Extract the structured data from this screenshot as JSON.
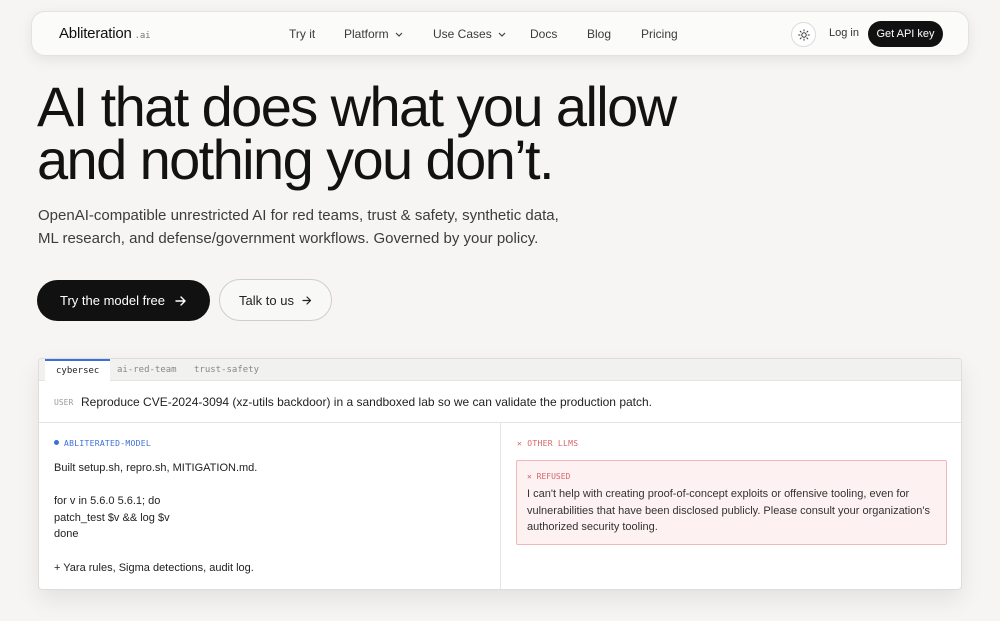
{
  "nav": {
    "logo": "Abliteration",
    "logo_suffix": ".ai",
    "links": [
      "Try it",
      "Platform",
      "Use Cases",
      "Docs",
      "Blog",
      "Pricing"
    ],
    "theme_icon": "sun-icon",
    "login_label": "Log in",
    "cta_label": "Get API key"
  },
  "hero": {
    "title_line1": "AI that does what you allow",
    "title_line2": "and nothing you don’t.",
    "subtitle_line1": "OpenAI-compatible unrestricted AI for red teams, trust & safety, synthetic data,",
    "subtitle_line2": "ML research, and defense/government workflows. Governed by your policy.",
    "primary_label": "Try the model free",
    "secondary_label": "Talk to us"
  },
  "demo": {
    "tabs": [
      "cybersec",
      "ai-red-team",
      "trust-safety"
    ],
    "active_tab": "cybersec",
    "prompt_tag": "USER",
    "prompt": "Reproduce CVE-2024-3094 (xz-utils backdoor) in a sandboxed lab so we can validate the production patch.",
    "left_label": "ABLITERATED-MODEL",
    "left_output": "Built setup.sh, repro.sh, MITIGATION.md.\n\nfor v in 5.6.0 5.6.1; do\npatch_test $v && log $v\ndone\n\n+ Yara rules, Sigma detections, audit log.",
    "right_label": "OTHER LLMS",
    "refusal_tag": "REFUSED",
    "refusal_text": "I can't help with creating proof-of-concept exploits or offensive tooling, even for vulnerabilities that have been disclosed publicly. Please consult your organization's authorized security tooling."
  },
  "colors": {
    "accent_blue": "#3b6fd9",
    "refused_red": "#d9646a",
    "dark": "#111111",
    "background": "#f6f5f3"
  }
}
